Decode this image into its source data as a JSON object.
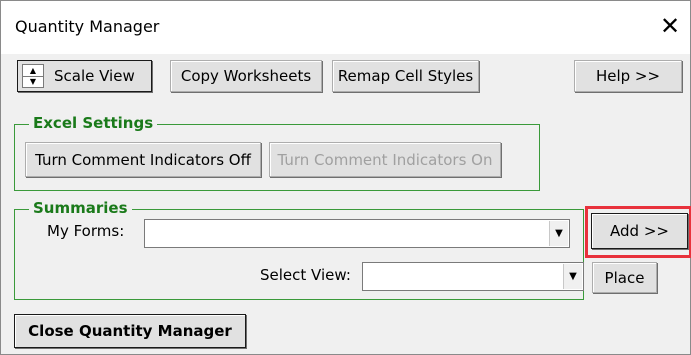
{
  "window": {
    "title": "Quantity Manager",
    "close_glyph": "✕"
  },
  "toolbar": {
    "scale_view_label": "Scale View",
    "copy_worksheets_label": "Copy Worksheets",
    "remap_cell_styles_label": "Remap Cell Styles",
    "help_label": "Help >>"
  },
  "icons": {
    "spin_up": "▲",
    "spin_down": "▼",
    "dropdown": "▼"
  },
  "excel_settings": {
    "title": "Excel Settings",
    "turn_off_label": "Turn Comment Indicators Off",
    "turn_on_label": "Turn Comment Indicators On"
  },
  "summaries": {
    "title": "Summaries",
    "my_forms_label": "My Forms:",
    "my_forms_value": "",
    "add_label": "Add >>",
    "select_view_label": "Select View:",
    "select_view_value": "",
    "place_label": "Place"
  },
  "footer": {
    "close_label": "Close Quantity Manager"
  },
  "colors": {
    "frame_border": "#3a9a3a",
    "frame_title": "#1a7a1a",
    "highlight": "#e8323c"
  }
}
